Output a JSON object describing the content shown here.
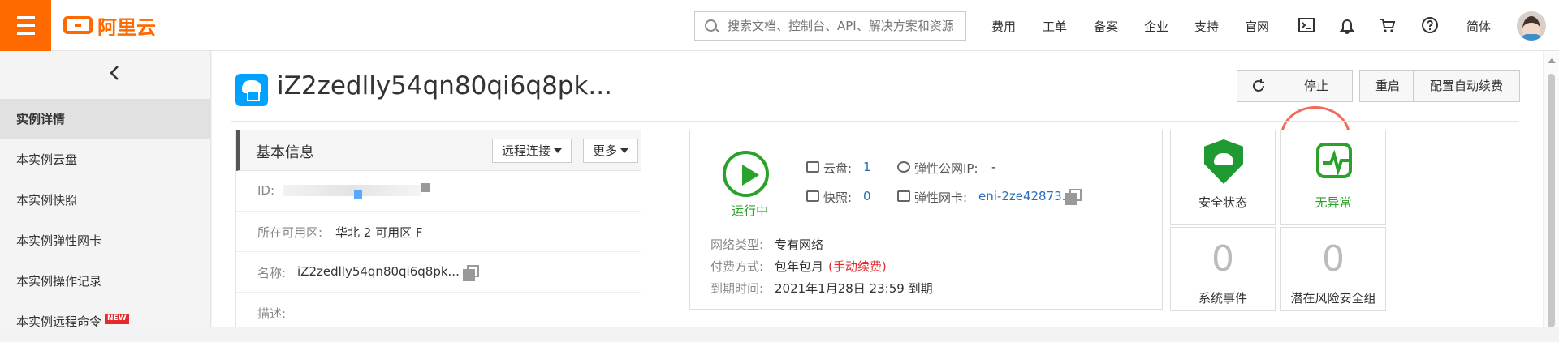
{
  "app": {
    "logo_text": "阿里云",
    "search_placeholder": "搜索文档、控制台、API、解决方案和资源"
  },
  "topnav": {
    "items": [
      "费用",
      "工单",
      "备案",
      "企业",
      "支持",
      "官网"
    ],
    "language": "简体"
  },
  "sidebar": {
    "items": [
      {
        "label": "实例详情",
        "active": true
      },
      {
        "label": "本实例云盘"
      },
      {
        "label": "本实例快照"
      },
      {
        "label": "本实例弹性网卡"
      },
      {
        "label": "本实例操作记录"
      },
      {
        "label": "本实例远程命令",
        "badge": "NEW"
      }
    ]
  },
  "page": {
    "title": "iZ2zedlly54qn80qi6q8pk...",
    "buttons": {
      "stop": "停止",
      "restart": "重启",
      "auto_renew": "配置自动续费"
    }
  },
  "basic_info": {
    "title": "基本信息",
    "remote_connect": "远程连接",
    "more": "更多",
    "fields": [
      {
        "key": "ID:",
        "value": ""
      },
      {
        "key": "所在可用区:",
        "value": "华北 2 可用区 F"
      },
      {
        "key": "名称:",
        "value": "iZ2zedlly54qn80qi6q8pk..."
      },
      {
        "key": "描述:",
        "value": ""
      }
    ]
  },
  "status": {
    "state": "运行中",
    "disk_label": "云盘:",
    "disk_count": "1",
    "snapshot_label": "快照:",
    "snapshot_count": "0",
    "public_ip_label": "弹性公网IP:",
    "public_ip_value": "-",
    "eni_label": "弹性网卡:",
    "eni_value": "eni-2ze42873...",
    "network_type_label": "网络类型:",
    "network_type_value": "专有网络",
    "payment_label": "付费方式:",
    "payment_value": "包年包月",
    "payment_note": "(手动续费)",
    "expire_label": "到期时间:",
    "expire_value": "2021年1月28日 23:59 到期"
  },
  "cards": [
    {
      "label": "安全状态",
      "icon": "shield-cloud-icon"
    },
    {
      "label": "无异常",
      "icon": "pulse-icon",
      "color": "#2aa12a"
    },
    {
      "label": "系统事件",
      "number": "0"
    },
    {
      "label": "潜在风险安全组",
      "number": "0"
    }
  ]
}
